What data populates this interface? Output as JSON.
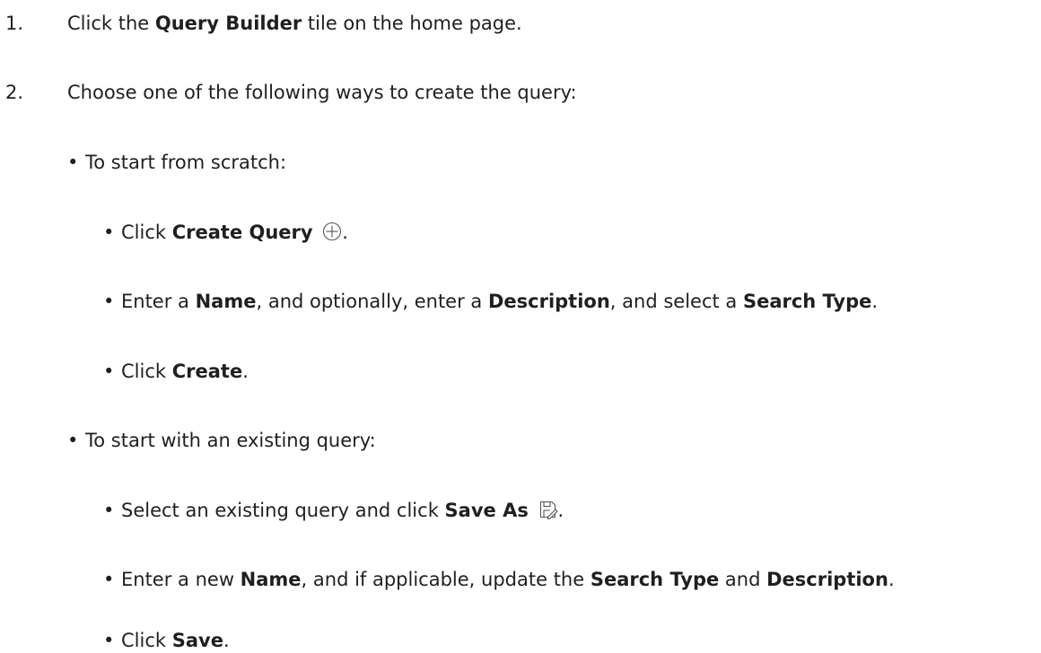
{
  "steps": [
    {
      "number": "1.",
      "pre": "Click the ",
      "bold": "Query Builder",
      "post": " tile on the home page."
    },
    {
      "number": "2.",
      "text": "Choose one of the following ways to create the query:"
    }
  ],
  "options": [
    {
      "label": "To start from scratch:",
      "items": [
        {
          "parts": [
            {
              "t": "Click ",
              "b": false
            },
            {
              "t": "Create Query",
              "b": true
            },
            {
              "t": " ",
              "b": false
            },
            {
              "icon": "plus-circle-icon"
            },
            {
              "t": ".",
              "b": false
            }
          ]
        },
        {
          "parts": [
            {
              "t": "Enter a ",
              "b": false
            },
            {
              "t": "Name",
              "b": true
            },
            {
              "t": ", and optionally, enter a ",
              "b": false
            },
            {
              "t": "Description",
              "b": true
            },
            {
              "t": ", and select a ",
              "b": false
            },
            {
              "t": "Search Type",
              "b": true
            },
            {
              "t": ".",
              "b": false
            }
          ]
        },
        {
          "parts": [
            {
              "t": "Click ",
              "b": false
            },
            {
              "t": "Create",
              "b": true
            },
            {
              "t": ".",
              "b": false
            }
          ]
        }
      ]
    },
    {
      "label": "To start with an existing query:",
      "items": [
        {
          "parts": [
            {
              "t": "Select an existing query and click ",
              "b": false
            },
            {
              "t": "Save As",
              "b": true
            },
            {
              "t": " ",
              "b": false
            },
            {
              "icon": "save-as-icon"
            },
            {
              "t": ".",
              "b": false
            }
          ]
        },
        {
          "parts": [
            {
              "t": "Enter a new ",
              "b": false
            },
            {
              "t": "Name",
              "b": true
            },
            {
              "t": ", and if applicable, update the ",
              "b": false
            },
            {
              "t": "Search Type",
              "b": true
            },
            {
              "t": " and ",
              "b": false
            },
            {
              "t": "Description",
              "b": true
            },
            {
              "t": ".",
              "b": false
            }
          ]
        },
        {
          "parts": [
            {
              "t": "Click ",
              "b": false
            },
            {
              "t": "Save",
              "b": true
            },
            {
              "t": ".",
              "b": false
            }
          ]
        }
      ]
    }
  ],
  "bullet_char": "•"
}
